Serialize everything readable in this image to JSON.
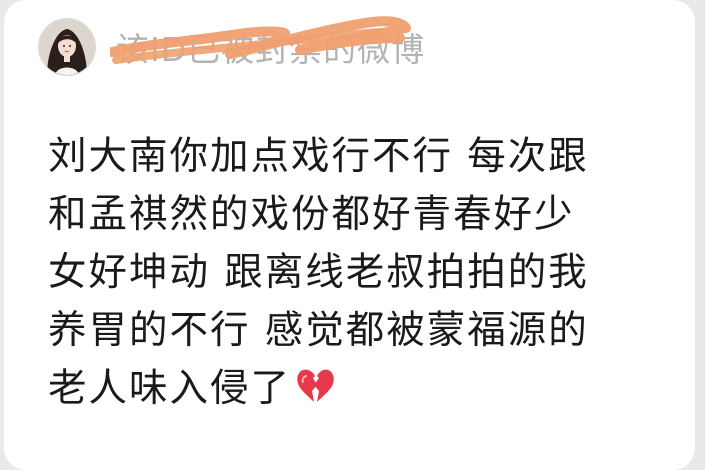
{
  "author": {
    "username": "该ID已被封禁的微博",
    "username_censored": true,
    "avatar_icon": "user-avatar"
  },
  "post": {
    "lines": [
      "刘大南你加点戏行不行 每次跟",
      "和孟祺然的戏份都好青春好少",
      "女好坤动 跟离线老叔拍拍的我",
      "养胃的不行 感觉都被蒙福源的",
      "老人味入侵了"
    ],
    "trailing_emoji": "broken-heart-icon"
  },
  "colors": {
    "card_background": "#ffffff",
    "page_background": "#e9e9e9",
    "censor_scribble": "#f0a070",
    "username_text": "#b3b3b3",
    "body_text": "#1a1a1a",
    "heart": "#e8394a"
  }
}
